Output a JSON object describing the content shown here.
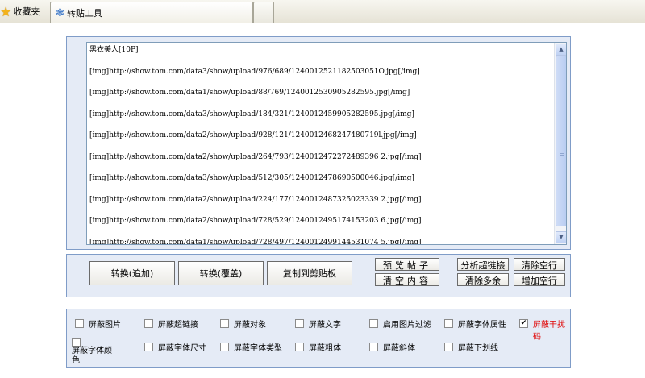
{
  "tabbar": {
    "favorites_label": "收藏夹",
    "active_tab_label": "转贴工具"
  },
  "editor": {
    "lines": [
      "黑衣美人[10P]",
      "[img]http://show.tom.com/data3/show/upload/976/689/1240012521182503051O.jpg[/img]",
      "[img]http://show.tom.com/data1/show/upload/88/769/1240012530905282595.jpg[/img]",
      "[img]http://show.tom.com/data3/show/upload/184/321/1240012459905282595.jpg[/img]",
      "[img]http://show.tom.com/data2/show/upload/928/121/1240012468247480719l.jpg[/img]",
      "[img]http://show.tom.com/data2/show/upload/264/793/1240012472272489396 2.jpg[/img]",
      "[img]http://show.tom.com/data3/show/upload/512/305/1240012478690500046.jpg[/img]",
      "[img]http://show.tom.com/data2/show/upload/224/177/1240012487325023339 2.jpg[/img]",
      "[img]http://show.tom.com/data2/show/upload/728/529/1240012495174153203 6.jpg[/img]",
      "[img]http://show.tom.com/data1/show/upload/728/497/1240012499144531074 5.jpg[/img]"
    ]
  },
  "buttons": {
    "convert_append": "转换(追加)",
    "convert_overwrite": "转换(覆盖)",
    "copy_clipboard": "复制到剪贴板",
    "preview_post": "预览帖子",
    "clear_content": "清空内容",
    "analyze_links": "分析超链接",
    "remove_extra": "清除多余",
    "remove_blank_lines": "清除空行",
    "add_blank_lines": "增加空行"
  },
  "options": [
    {
      "label": "屏蔽图片",
      "checked": false
    },
    {
      "label": "屏蔽超链接",
      "checked": false
    },
    {
      "label": "屏蔽对象",
      "checked": false
    },
    {
      "label": "屏蔽文字",
      "checked": false
    },
    {
      "label": "启用图片过滤",
      "checked": false
    },
    {
      "label": "屏蔽字体属性",
      "checked": false
    },
    {
      "label": "屏蔽干扰码",
      "checked": true,
      "color": "#e00000"
    },
    {
      "label": "屏蔽字体颜色",
      "checked": false
    },
    {
      "label": "屏蔽字体尺寸",
      "checked": false
    },
    {
      "label": "屏蔽字体类型",
      "checked": false
    },
    {
      "label": "屏蔽粗体",
      "checked": false
    },
    {
      "label": "屏蔽斜体",
      "checked": false
    },
    {
      "label": "屏蔽下划线",
      "checked": false
    }
  ]
}
